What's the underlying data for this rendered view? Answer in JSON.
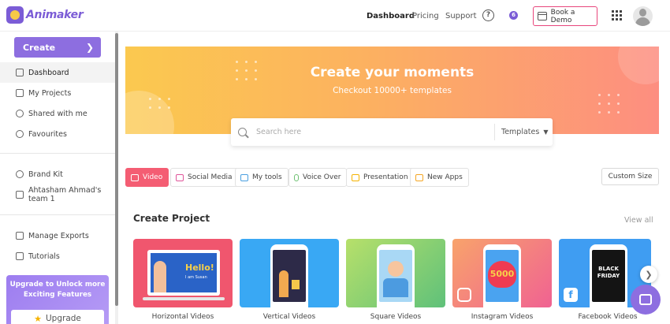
{
  "brand": {
    "name": "Animaker"
  },
  "header": {
    "nav": [
      "Dashboard",
      "Pricing",
      "Support"
    ],
    "notification_count": "6",
    "help_icon": "?",
    "demo_label": "Book a Demo"
  },
  "sidebar": {
    "create_label": "Create",
    "items_top": [
      "Dashboard",
      "My Projects",
      "Shared with me",
      "Favourites"
    ],
    "items_mid": [
      "Brand Kit",
      "Ahtasham Ahmad's team 1"
    ],
    "items_bottom": [
      "Manage Exports",
      "Tutorials"
    ],
    "upgrade_text_1": "Upgrade to Unlock more",
    "upgrade_text_2": "Exciting Features",
    "upgrade_button": "Upgrade"
  },
  "banner": {
    "title": "Create your moments",
    "subtitle": "Checkout 10000+ templates",
    "search_placeholder": "Search here",
    "search_filter": "Templates"
  },
  "tabs": [
    {
      "label": "Video",
      "icon": "video-icon",
      "color": "#f45d73"
    },
    {
      "label": "Social Media",
      "icon": "social-media-icon",
      "color": "#e0559a"
    },
    {
      "label": "My tools",
      "icon": "tools-icon",
      "color": "#4a9fe0"
    },
    {
      "label": "Voice Over",
      "icon": "microphone-icon",
      "color": "#6cc070"
    },
    {
      "label": "Presentation",
      "icon": "presentation-icon",
      "color": "#f5b301"
    },
    {
      "label": "New Apps",
      "icon": "apps-icon",
      "color": "#f5a623"
    }
  ],
  "custom_size_label": "Custom Size",
  "project": {
    "title": "Create Project",
    "view_all": "View all",
    "cards": [
      {
        "label": "Horizontal Videos",
        "bg": "#f0566e"
      },
      {
        "label": "Vertical Videos",
        "bg": "#39a8f4"
      },
      {
        "label": "Square Videos",
        "bg": "#8fd16a"
      },
      {
        "label": "Instagram Videos",
        "bg": "#f4797f"
      },
      {
        "label": "Facebook Videos",
        "bg": "#3f9df2"
      }
    ],
    "card_texts": {
      "hello": "Hello!",
      "name": "I am Susan",
      "number": "5000",
      "black": "BLACK",
      "friday": "FRIDAY"
    }
  }
}
